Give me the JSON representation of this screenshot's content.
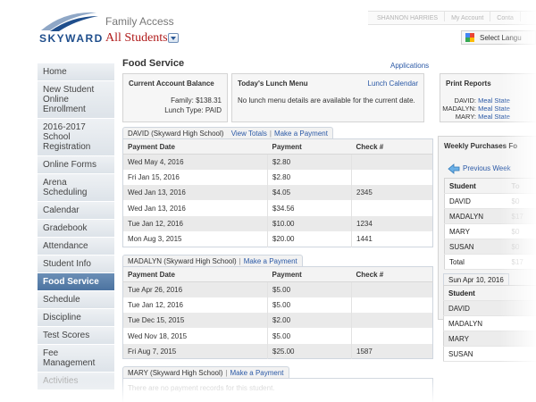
{
  "header": {
    "logo_text": "SKYWARD",
    "app_title": "Family Access",
    "student_selector": "All Students",
    "top_links": [
      "SHANNON HARRIES",
      "My Account",
      "Conta"
    ],
    "language": "Select Langu"
  },
  "sidebar": {
    "items": [
      {
        "label": "Home"
      },
      {
        "label": "New Student Online Enrollment"
      },
      {
        "label": "2016-2017 School Registration"
      },
      {
        "label": "Online Forms"
      },
      {
        "label": "Arena Scheduling"
      },
      {
        "label": "Calendar"
      },
      {
        "label": "Gradebook"
      },
      {
        "label": "Attendance"
      },
      {
        "label": "Student Info"
      },
      {
        "label": "Food Service"
      },
      {
        "label": "Schedule"
      },
      {
        "label": "Discipline"
      },
      {
        "label": "Test Scores"
      },
      {
        "label": "Fee Management"
      },
      {
        "label": "Activities"
      }
    ]
  },
  "main": {
    "title": "Food Service",
    "applications_link": "Applications",
    "account_balance": {
      "title": "Current Account Balance",
      "family_label": "Family:",
      "family_value": "$138.31",
      "lunch_type_label": "Lunch Type:",
      "lunch_type_value": "PAID"
    },
    "lunch_menu": {
      "title": "Today's Lunch Menu",
      "calendar_link": "Lunch Calendar",
      "message": "No lunch menu details are available for the current date."
    },
    "print_reports": {
      "title": "Print Reports",
      "rows": [
        {
          "name": "DAVID:",
          "link": "Meal State"
        },
        {
          "name": "MADALYN:",
          "link": "Meal State"
        },
        {
          "name": "MARY:",
          "link": "Meal State"
        }
      ]
    },
    "david": {
      "tab": "DAVID (Skyward High School)",
      "view_totals": "View Totals",
      "make_payment": "Make a Payment",
      "headers": [
        "Payment Date",
        "Payment",
        "Check #"
      ],
      "rows": [
        [
          "Wed May 4, 2016",
          "$2.80",
          ""
        ],
        [
          "Fri Jan 15, 2016",
          "$2.80",
          ""
        ],
        [
          "Wed Jan 13, 2016",
          "$4.05",
          "2345"
        ],
        [
          "Wed Jan 13, 2016",
          "$34.56",
          ""
        ],
        [
          "Tue Jan 12, 2016",
          "$10.00",
          "1234"
        ],
        [
          "Mon Aug 3, 2015",
          "$20.00",
          "1441"
        ]
      ]
    },
    "madalyn": {
      "tab": "MADALYN (Skyward High School)",
      "make_payment": "Make a Payment",
      "headers": [
        "Payment Date",
        "Payment",
        "Check #"
      ],
      "rows": [
        [
          "Tue Apr 26, 2016",
          "$5.00",
          ""
        ],
        [
          "Tue Jan 12, 2016",
          "$5.00",
          ""
        ],
        [
          "Tue Dec 15, 2015",
          "$2.00",
          ""
        ],
        [
          "Wed Nov 18, 2015",
          "$5.00",
          ""
        ],
        [
          "Fri Aug 7, 2015",
          "$25.00",
          "1587"
        ]
      ]
    },
    "mary": {
      "tab": "MARY (Skyward High School)",
      "make_payment": "Make a Payment",
      "message": "There are no payment records for this student."
    },
    "weekly": {
      "title": "Weekly Purchases Fo",
      "previous_week": "Previous Week",
      "headers": [
        "Student",
        "To"
      ],
      "rows": [
        [
          "DAVID",
          "$0"
        ],
        [
          "MADALYN",
          "$17"
        ],
        [
          "MARY",
          "$0"
        ],
        [
          "SUSAN",
          "$0"
        ],
        [
          "Total",
          "$17"
        ]
      ]
    },
    "sunday": {
      "tab": "Sun Apr 10, 2016",
      "headers": [
        "Student",
        ""
      ],
      "rows": [
        [
          "DAVID",
          ""
        ],
        [
          "MADALYN",
          ""
        ],
        [
          "MARY",
          ""
        ],
        [
          "SUSAN",
          ""
        ]
      ]
    }
  },
  "colors": {
    "brand_blue": "#1f4e8c",
    "link_blue": "#2b59a6",
    "active_nav": "#5a80ac",
    "student_red": "#b01c1c"
  }
}
